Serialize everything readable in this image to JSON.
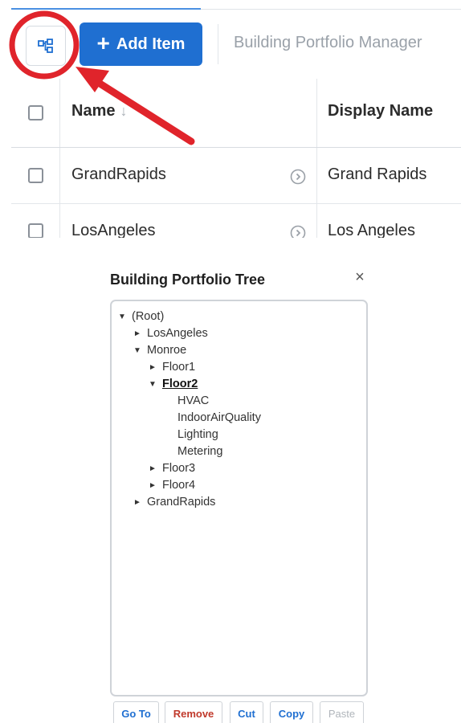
{
  "toolbar": {
    "tree_icon": "tree-structure-icon",
    "add_plus": "+",
    "add_label": "Add Item",
    "app_title": "Building Portfolio Manager"
  },
  "grid": {
    "columns": {
      "name": "Name",
      "display_name": "Display Name"
    },
    "sort_indicator": "↓",
    "rows": [
      {
        "name": "GrandRapids",
        "display_name": "Grand Rapids"
      },
      {
        "name": "LosAngeles",
        "display_name": "Los Angeles"
      }
    ]
  },
  "annotation": {
    "color": "#e0242b"
  },
  "dialog": {
    "title": "Building Portfolio Tree",
    "close": "×",
    "tree": {
      "root": "(Root)",
      "losangeles": "LosAngeles",
      "monroe": "Monroe",
      "floor1": "Floor1",
      "floor2": "Floor2",
      "hvac": "HVAC",
      "iaq": "IndoorAirQuality",
      "lighting": "Lighting",
      "metering": "Metering",
      "floor3": "Floor3",
      "floor4": "Floor4",
      "grandrapids": "GrandRapids"
    },
    "expanded": "▼",
    "collapsed": "►",
    "buttons": {
      "goto": "Go To",
      "remove": "Remove",
      "cut": "Cut",
      "copy": "Copy",
      "paste": "Paste"
    }
  },
  "colors": {
    "primary": "#1f6fd1",
    "danger": "#c0392b",
    "disabled": "#b0b5bb"
  }
}
